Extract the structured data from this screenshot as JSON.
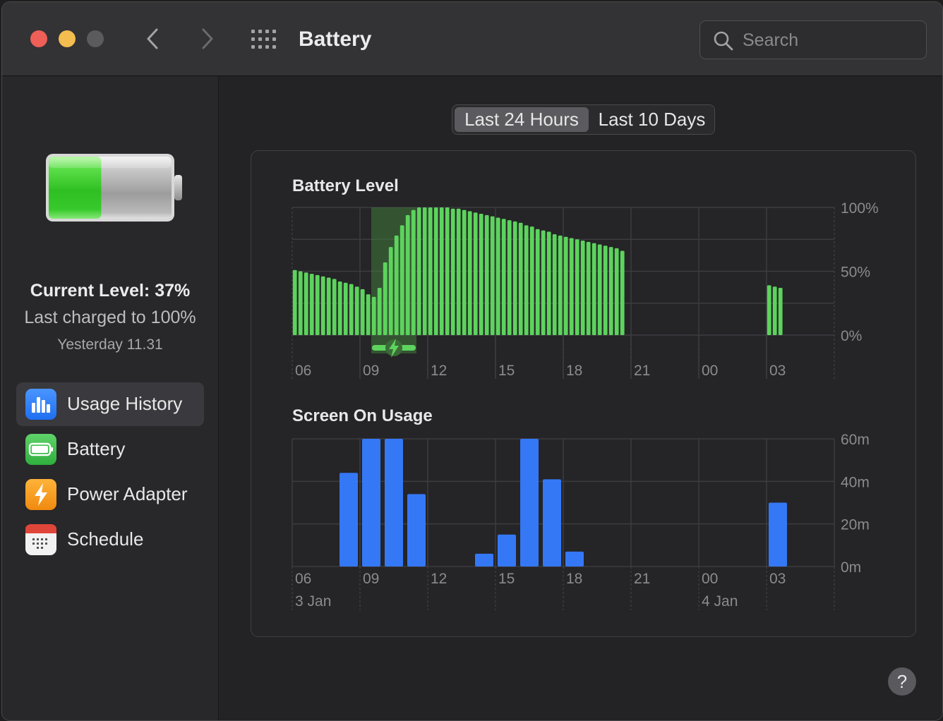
{
  "window": {
    "title": "Battery",
    "search_placeholder": "Search",
    "traffic_lights": {
      "close": "#ed5f57",
      "minimize": "#f4bd4f",
      "maximize": "#5b5b5e"
    },
    "nav_icons": [
      "chevron-left-icon",
      "chevron-right-icon",
      "grid-icon"
    ]
  },
  "sidebar": {
    "battery_fill_fraction": 0.37,
    "current_level": "Current Level: 37%",
    "last_charged": "Last charged to 100%",
    "charged_time": "Yesterday 11.31",
    "items": [
      {
        "label": "Usage History",
        "icon": "usage-history-icon",
        "selected": true,
        "color": "#2f7cf6"
      },
      {
        "label": "Battery",
        "icon": "battery-icon",
        "selected": false,
        "color": "#34c759"
      },
      {
        "label": "Power Adapter",
        "icon": "power-adapter-icon",
        "selected": false,
        "color": "#f59e0b"
      },
      {
        "label": "Schedule",
        "icon": "calendar-icon",
        "selected": false,
        "color": "#e5e5e5"
      }
    ]
  },
  "tabs": [
    {
      "label": "Last 24 Hours",
      "active": true
    },
    {
      "label": "Last 10 Days",
      "active": false
    }
  ],
  "help_label": "?",
  "chart_data": [
    {
      "type": "bar",
      "title": "Battery Level",
      "color": "#5dd35d",
      "x_ticks": [
        "06",
        "09",
        "12",
        "15",
        "18",
        "21",
        "00",
        "03"
      ],
      "y_ticks": [
        "100%",
        "50%",
        "0%"
      ],
      "ylim": [
        0,
        100
      ],
      "unit": "%",
      "charging_interval": {
        "start_index": 14,
        "end_index": 21
      },
      "bars": [
        {
          "i": 0,
          "v": 51
        },
        {
          "i": 1,
          "v": 50
        },
        {
          "i": 2,
          "v": 49
        },
        {
          "i": 3,
          "v": 48
        },
        {
          "i": 4,
          "v": 47
        },
        {
          "i": 5,
          "v": 46
        },
        {
          "i": 6,
          "v": 45
        },
        {
          "i": 7,
          "v": 44
        },
        {
          "i": 8,
          "v": 42
        },
        {
          "i": 9,
          "v": 41
        },
        {
          "i": 10,
          "v": 40
        },
        {
          "i": 11,
          "v": 38
        },
        {
          "i": 12,
          "v": 36
        },
        {
          "i": 13,
          "v": 32
        },
        {
          "i": 14,
          "v": 30
        },
        {
          "i": 15,
          "v": 37
        },
        {
          "i": 16,
          "v": 57
        },
        {
          "i": 17,
          "v": 69
        },
        {
          "i": 18,
          "v": 78
        },
        {
          "i": 19,
          "v": 86
        },
        {
          "i": 20,
          "v": 94
        },
        {
          "i": 21,
          "v": 98
        },
        {
          "i": 22,
          "v": 100
        },
        {
          "i": 23,
          "v": 100
        },
        {
          "i": 24,
          "v": 100
        },
        {
          "i": 25,
          "v": 100
        },
        {
          "i": 26,
          "v": 100
        },
        {
          "i": 27,
          "v": 100
        },
        {
          "i": 28,
          "v": 99
        },
        {
          "i": 29,
          "v": 99
        },
        {
          "i": 30,
          "v": 98
        },
        {
          "i": 31,
          "v": 97
        },
        {
          "i": 32,
          "v": 96
        },
        {
          "i": 33,
          "v": 95
        },
        {
          "i": 34,
          "v": 94
        },
        {
          "i": 35,
          "v": 93
        },
        {
          "i": 36,
          "v": 92
        },
        {
          "i": 37,
          "v": 91
        },
        {
          "i": 38,
          "v": 90
        },
        {
          "i": 39,
          "v": 89
        },
        {
          "i": 40,
          "v": 88
        },
        {
          "i": 41,
          "v": 86
        },
        {
          "i": 42,
          "v": 85
        },
        {
          "i": 43,
          "v": 83
        },
        {
          "i": 44,
          "v": 82
        },
        {
          "i": 45,
          "v": 81
        },
        {
          "i": 46,
          "v": 79
        },
        {
          "i": 47,
          "v": 78
        },
        {
          "i": 48,
          "v": 77
        },
        {
          "i": 49,
          "v": 76
        },
        {
          "i": 50,
          "v": 75
        },
        {
          "i": 51,
          "v": 74
        },
        {
          "i": 52,
          "v": 73
        },
        {
          "i": 53,
          "v": 72
        },
        {
          "i": 54,
          "v": 71
        },
        {
          "i": 55,
          "v": 70
        },
        {
          "i": 56,
          "v": 69
        },
        {
          "i": 57,
          "v": 68
        },
        {
          "i": 58,
          "v": 66
        },
        {
          "i": 84,
          "v": 39
        },
        {
          "i": 85,
          "v": 38
        },
        {
          "i": 86,
          "v": 37
        }
      ]
    },
    {
      "type": "bar",
      "title": "Screen On Usage",
      "color": "#3478f6",
      "x_ticks": [
        "06",
        "09",
        "12",
        "15",
        "18",
        "21",
        "00",
        "03"
      ],
      "date_labels": [
        {
          "tick_index": 0,
          "label": "3 Jan"
        },
        {
          "tick_index": 6,
          "label": "4 Jan"
        }
      ],
      "y_ticks": [
        "60m",
        "40m",
        "20m",
        "0m"
      ],
      "ylim": [
        0,
        60
      ],
      "unit": "minutes",
      "bars": [
        {
          "hour": 2,
          "v": 44
        },
        {
          "hour": 3,
          "v": 60
        },
        {
          "hour": 4,
          "v": 60
        },
        {
          "hour": 5,
          "v": 34
        },
        {
          "hour": 8,
          "v": 6
        },
        {
          "hour": 9,
          "v": 15
        },
        {
          "hour": 10,
          "v": 60
        },
        {
          "hour": 11,
          "v": 41
        },
        {
          "hour": 12,
          "v": 7
        },
        {
          "hour": 21,
          "v": 30
        }
      ]
    }
  ]
}
